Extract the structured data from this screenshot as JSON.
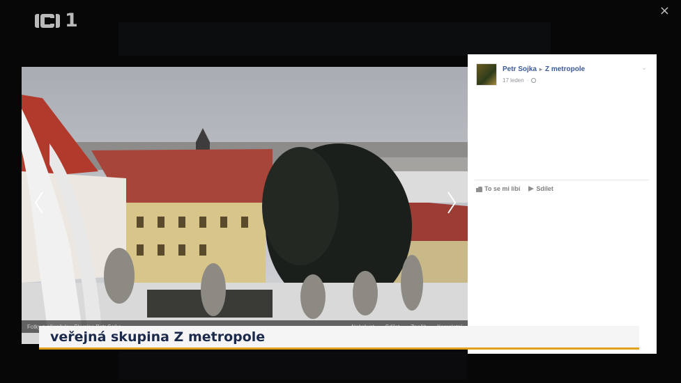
{
  "broadcast": {
    "logo_text": "1",
    "caption": "veřejná skupina Z metropole"
  },
  "post": {
    "author": "Petr Sojka",
    "group": "Z metropole",
    "date": "17 leden",
    "like_label": "To se mi líbí",
    "share_label": "Sdílet"
  },
  "photo": {
    "footer_left": "Fotky z příspěvku: Skupina Petr Sojka",
    "footer_items": [
      "Nahrávat",
      "Sdílet",
      "Značit",
      "Kompletní"
    ]
  },
  "icons": {
    "close": "close-icon",
    "like": "thumbs-up-icon",
    "share": "share-arrow-icon",
    "globe": "globe-icon",
    "chevron": "chevron-down-icon"
  },
  "colors": {
    "caption_text": "#1c2a4c",
    "caption_accent": "#e1a019",
    "fb_link": "#3b5998"
  }
}
